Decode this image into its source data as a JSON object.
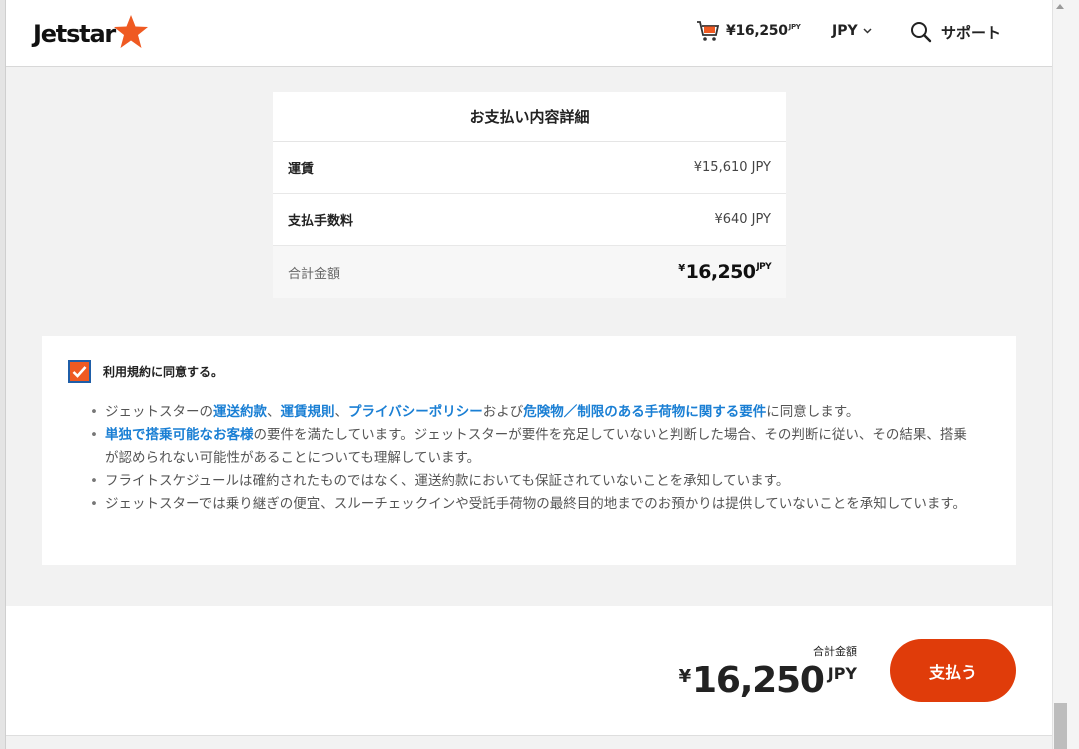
{
  "header": {
    "logo_text": "Jetstar",
    "cart_amount": "¥16,250",
    "cart_unit": "JPY",
    "currency": "JPY",
    "support_label": "サポート"
  },
  "details": {
    "title": "お支払い内容詳細",
    "rows": [
      {
        "label": "運賃",
        "value": "¥15,610 JPY"
      },
      {
        "label": "支払手数料",
        "value": "¥640 JPY"
      }
    ],
    "total": {
      "label": "合計金額",
      "symbol": "¥",
      "amount": "16,250",
      "unit": "JPY"
    }
  },
  "terms": {
    "checked": true,
    "agree_label": "利用規約に同意する。",
    "items": [
      {
        "parts": [
          {
            "t": "ジェットスターの"
          },
          {
            "t": "運送約款",
            "link": true
          },
          {
            "t": "、"
          },
          {
            "t": "運賃規則",
            "link": true
          },
          {
            "t": "、"
          },
          {
            "t": "プライバシーポリシー",
            "link": true
          },
          {
            "t": "および"
          },
          {
            "t": "危険物／制限のある手荷物に関する要件",
            "link": true
          },
          {
            "t": "に同意します。"
          }
        ]
      },
      {
        "parts": [
          {
            "t": "単独で搭乗可能なお客様",
            "link": true
          },
          {
            "t": "の要件を満たしています。ジェットスターが要件を充足していないと判断した場合、その判断に従い、その結果、搭乗が認められない可能性があることについても理解しています。"
          }
        ]
      },
      {
        "parts": [
          {
            "t": "フライトスケジュールは確約されたものではなく、運送約款においても保証されていないことを承知しています。"
          }
        ]
      },
      {
        "parts": [
          {
            "t": "ジェットスターでは乗り継ぎの便宜、スルーチェックインや受託手荷物の最終目的地までのお預かりは提供していないことを承知しています。"
          }
        ]
      }
    ]
  },
  "footer": {
    "total_label": "合計金額",
    "symbol": "¥",
    "amount": "16,250",
    "unit": "JPY",
    "pay_label": "支払う"
  },
  "colors": {
    "brand_orange": "#ef5a22",
    "pay_button": "#e03c0a",
    "link_blue": "#1a7fd4"
  }
}
